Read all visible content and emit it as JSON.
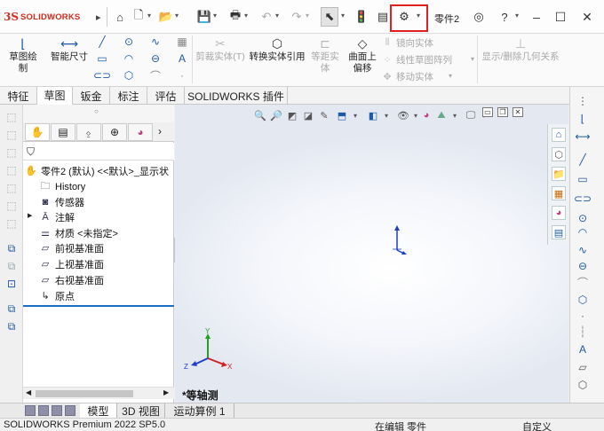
{
  "titlebar": {
    "logo": "SOLIDWORKS",
    "document_name": "零件2",
    "colors": {
      "brand": "#d52b1e",
      "highlight": "#e02020"
    }
  },
  "command_manager": {
    "sketch_label": "草图绘制",
    "smart_dimension_label": "智能尺寸",
    "trim_label": "剪裁实体(T)",
    "convert_label": "转换实体引用",
    "offset_label_1": "等距实",
    "offset_label_2": "体",
    "surface_offset_label_1": "曲面上",
    "surface_offset_label_2": "偏移",
    "mirror_label": "镜向实体",
    "linear_pattern_label": "线性草图阵列",
    "move_label": "移动实体",
    "display_relations_label": "显示/删除几何关系"
  },
  "tabs": [
    {
      "label": "特征"
    },
    {
      "label": "草图"
    },
    {
      "label": "钣金"
    },
    {
      "label": "标注"
    },
    {
      "label": "评估"
    },
    {
      "label": "SOLIDWORKS 插件"
    }
  ],
  "feature_tree": {
    "root": "零件2 (默认) <<默认>_显示状",
    "items": [
      {
        "label": "History"
      },
      {
        "label": "传感器"
      },
      {
        "label": "注解"
      },
      {
        "label": "材质 <未指定>"
      },
      {
        "label": "前视基准面"
      },
      {
        "label": "上视基准面"
      },
      {
        "label": "右视基准面"
      },
      {
        "label": "原点"
      }
    ]
  },
  "graphics": {
    "view_label": "*等轴测",
    "triad": {
      "x": "X",
      "y": "Y",
      "z": "Z"
    }
  },
  "bottom_tabs": [
    {
      "label": "模型"
    },
    {
      "label": "3D 视图"
    },
    {
      "label": "运动算例 1"
    }
  ],
  "status_bar": {
    "product": "SOLIDWORKS Premium 2022 SP5.0",
    "mode": "在编辑 零件",
    "units": "自定义"
  }
}
